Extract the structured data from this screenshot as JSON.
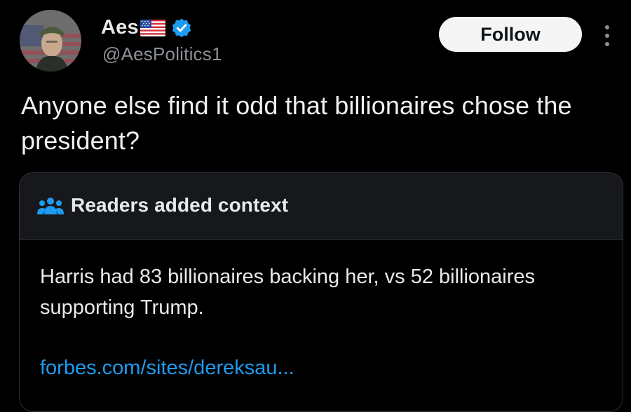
{
  "post": {
    "author": {
      "display_name": "Aes",
      "handle": "@AesPolitics1",
      "verified": true,
      "flag_icon": "us-flag-emoji",
      "avatar_icon": "profile-avatar"
    },
    "follow_label": "Follow",
    "more_icon": "vertical-ellipsis-icon",
    "text": "Anyone else find it odd that billionaires chose the president?"
  },
  "community_note": {
    "icon": "readers-people-icon",
    "title": "Readers added context",
    "body": "Harris had 83 billionaires backing her, vs 52 billionaires supporting Trump.",
    "link": "forbes.com/sites/dereksau..."
  },
  "colors": {
    "background": "#000000",
    "text": "#e7e9ea",
    "secondary_text": "#8b9096",
    "link": "#1d9bf0",
    "verified": "#1d9bf0",
    "note_header_bg": "#16181c",
    "border": "#2f3336",
    "follow_button_bg": "#f5f5f5"
  }
}
